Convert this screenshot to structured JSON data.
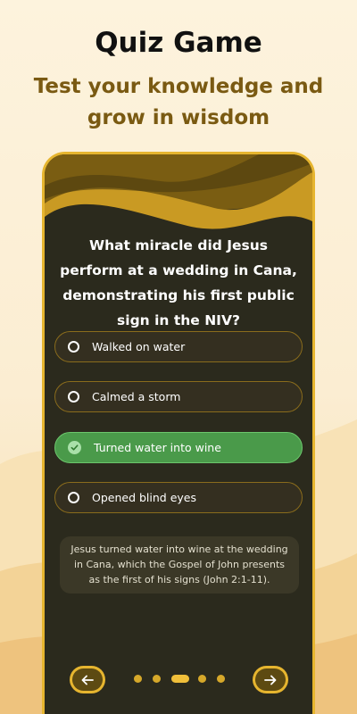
{
  "promo": {
    "title": "Quiz Game",
    "subtitle": "Test your knowledge and grow in wisdom"
  },
  "quiz": {
    "question": "What miracle did Jesus perform at a wedding in Cana, demonstrating his first public sign in the NIV?",
    "options": [
      {
        "label": "Walked on water",
        "state": "unselected"
      },
      {
        "label": "Calmed a storm",
        "state": "unselected"
      },
      {
        "label": "Turned water into wine",
        "state": "correct"
      },
      {
        "label": "Opened blind eyes",
        "state": "unselected"
      }
    ],
    "explanation": "Jesus turned water into wine at the wedding in Cana, which the Gospel of John presents as the first of his signs (John 2:1-11).",
    "pagination": {
      "total": 5,
      "active_index": 2
    }
  },
  "icons": {
    "prev": "arrow-left-icon",
    "next": "arrow-right-icon",
    "unselected": "radio-circle-icon",
    "correct": "check-circle-icon"
  },
  "colors": {
    "accent": "#e6b52f",
    "card_background": "#2b2a1d",
    "correct": "#4a9a4a",
    "subtitle": "#7a5a12"
  }
}
